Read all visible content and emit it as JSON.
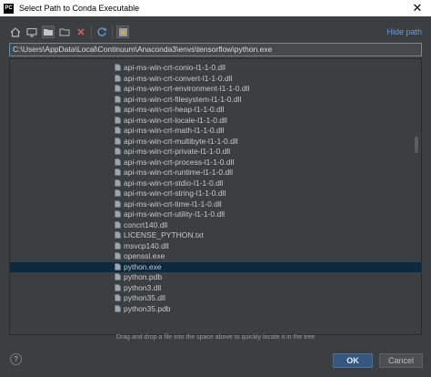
{
  "window": {
    "title": "Select Path to Conda Executable",
    "app_icon": "PC",
    "close_glyph": "✕"
  },
  "toolbar": {
    "hide_path": "Hide path"
  },
  "path_field": {
    "value": "C:\\Users\\AppData\\Local\\Continuum\\Anaconda3\\envs\\tensorflow\\python.exe"
  },
  "files": [
    "api-ms-win-crt-conio-l1-1-0.dll",
    "api-ms-win-crt-convert-l1-1-0.dll",
    "api-ms-win-crt-environment-l1-1-0.dll",
    "api-ms-win-crt-filesystem-l1-1-0.dll",
    "api-ms-win-crt-heap-l1-1-0.dll",
    "api-ms-win-crt-locale-l1-1-0.dll",
    "api-ms-win-crt-math-l1-1-0.dll",
    "api-ms-win-crt-multibyte-l1-1-0.dll",
    "api-ms-win-crt-private-l1-1-0.dll",
    "api-ms-win-crt-process-l1-1-0.dll",
    "api-ms-win-crt-runtime-l1-1-0.dll",
    "api-ms-win-crt-stdio-l1-1-0.dll",
    "api-ms-win-crt-string-l1-1-0.dll",
    "api-ms-win-crt-time-l1-1-0.dll",
    "api-ms-win-crt-utility-l1-1-0.dll",
    "concrt140.dll",
    "LICENSE_PYTHON.txt",
    "msvcp140.dll",
    "openssl.exe",
    "python.exe",
    "python.pdb",
    "python3.dll",
    "python35.dll",
    "python35.pdb"
  ],
  "selected_file": "python.exe",
  "hint": "Drag and drop a file into the space above to quickly locate it in the tree",
  "buttons": {
    "help": "?",
    "ok": "OK",
    "cancel": "Cancel"
  },
  "colors": {
    "accent": "#589df6",
    "selection": "#0d293e",
    "ok_button": "#365880"
  }
}
